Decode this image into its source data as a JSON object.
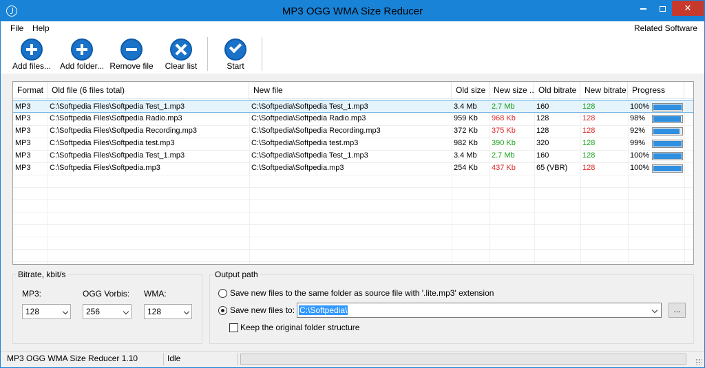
{
  "window": {
    "title": "MP3 OGG WMA Size Reducer",
    "controls": {
      "minimize": "minimize",
      "maximize": "maximize",
      "close": "✕"
    },
    "accent": "#1883d7",
    "close_color": "#c7392d"
  },
  "menu": {
    "items": [
      "File",
      "Help"
    ],
    "related": "Related Software"
  },
  "toolbar": {
    "buttons": [
      {
        "label": "Add files...",
        "icon": "plus-circle-icon"
      },
      {
        "label": "Add folder...",
        "icon": "plus-circle-icon"
      },
      {
        "label": "Remove file",
        "icon": "minus-circle-icon"
      },
      {
        "label": "Clear list",
        "icon": "x-circle-icon"
      },
      {
        "label": "Start",
        "icon": "check-circle-icon"
      }
    ]
  },
  "table": {
    "columns": [
      "Format",
      "Old file (6 files total)",
      "New file",
      "Old size",
      "New size ...",
      "Old bitrate",
      "New bitrate",
      "Progress"
    ],
    "rows": [
      {
        "format": "MP3",
        "old_file": "C:\\Softpedia Files\\Softpedia Test_1.mp3",
        "new_file": "C:\\Softpedia\\Softpedia Test_1.mp3",
        "old_size": "3.4 Mb",
        "new_size": "2.7 Mb",
        "new_size_status": "smaller",
        "old_bitrate": "160",
        "new_bitrate": "128",
        "new_bitrate_status": "smaller",
        "progress_label": "100%",
        "progress": 1.0,
        "selected": true
      },
      {
        "format": "MP3",
        "old_file": "C:\\Softpedia Files\\Softpedia Radio.mp3",
        "new_file": "C:\\Softpedia\\Softpedia Radio.mp3",
        "old_size": "959 Kb",
        "new_size": "968 Kb",
        "new_size_status": "larger",
        "old_bitrate": "128",
        "new_bitrate": "128",
        "new_bitrate_status": "same",
        "progress_label": "98%",
        "progress": 0.98,
        "selected": false
      },
      {
        "format": "MP3",
        "old_file": "C:\\Softpedia Files\\Softpedia Recording.mp3",
        "new_file": "C:\\Softpedia\\Softpedia Recording.mp3",
        "old_size": "372 Kb",
        "new_size": "375 Kb",
        "new_size_status": "larger",
        "old_bitrate": "128",
        "new_bitrate": "128",
        "new_bitrate_status": "same",
        "progress_label": "92%",
        "progress": 0.92,
        "selected": false
      },
      {
        "format": "MP3",
        "old_file": "C:\\Softpedia Files\\Softpedia test.mp3",
        "new_file": "C:\\Softpedia\\Softpedia test.mp3",
        "old_size": "982 Kb",
        "new_size": "390 Kb",
        "new_size_status": "smaller",
        "old_bitrate": "320",
        "new_bitrate": "128",
        "new_bitrate_status": "smaller",
        "progress_label": "99%",
        "progress": 0.99,
        "selected": false
      },
      {
        "format": "MP3",
        "old_file": "C:\\Softpedia Files\\Softpedia Test_1.mp3",
        "new_file": "C:\\Softpedia\\Softpedia Test_1.mp3",
        "old_size": "3.4 Mb",
        "new_size": "2.7 Mb",
        "new_size_status": "smaller",
        "old_bitrate": "160",
        "new_bitrate": "128",
        "new_bitrate_status": "smaller",
        "progress_label": "100%",
        "progress": 1.0,
        "selected": false
      },
      {
        "format": "MP3",
        "old_file": "C:\\Softpedia Files\\Softpedia.mp3",
        "new_file": "C:\\Softpedia\\Softpedia.mp3",
        "old_size": "254 Kb",
        "new_size": "437 Kb",
        "new_size_status": "larger",
        "old_bitrate": "65 (VBR)",
        "new_bitrate": "128",
        "new_bitrate_status": "larger",
        "progress_label": "100%",
        "progress": 1.0,
        "selected": false
      }
    ],
    "status_colors": {
      "smaller": "#17a317",
      "larger": "#e02828",
      "same": "#e02828"
    }
  },
  "bitrate": {
    "title": "Bitrate, kbit/s",
    "mp3_label": "MP3:",
    "mp3_value": "128",
    "ogg_label": "OGG Vorbis:",
    "ogg_value": "256",
    "wma_label": "WMA:",
    "wma_value": "128"
  },
  "output": {
    "title": "Output path",
    "option_same": "Save new files to the same folder as source file with '.lite.mp3' extension",
    "option_custom": "Save new files to:",
    "path_value": "C:\\Softpedia\\",
    "browse_label": "...",
    "keep_structure": "Keep the original folder structure"
  },
  "status": {
    "app_version": "MP3 OGG WMA Size Reducer 1.10",
    "state": "Idle"
  }
}
